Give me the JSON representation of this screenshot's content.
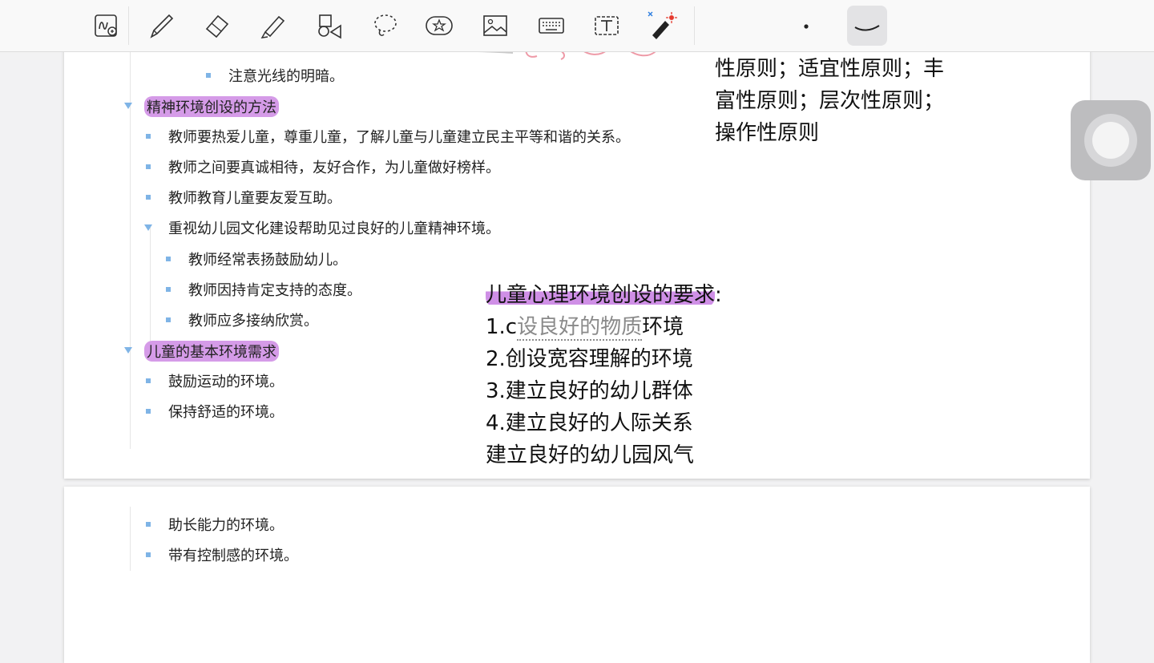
{
  "toolbar": {
    "tools": [
      {
        "name": "handwriting-zoom-icon"
      },
      {
        "name": "pen-icon"
      },
      {
        "name": "eraser-icon"
      },
      {
        "name": "highlighter-icon"
      },
      {
        "name": "shapes-icon"
      },
      {
        "name": "lasso-icon"
      },
      {
        "name": "sticker-icon"
      },
      {
        "name": "image-icon"
      },
      {
        "name": "keyboard-icon"
      },
      {
        "name": "text-box-icon"
      },
      {
        "name": "laser-pointer-icon"
      },
      {
        "name": "stroke-size-dot-icon"
      },
      {
        "name": "stroke-style-icon"
      }
    ],
    "accent": "#7fb4e6"
  },
  "page1": {
    "items": [
      {
        "text": "注意光线的明暗。"
      },
      {
        "text": "精神环境创设的方法"
      },
      {
        "text": "教师要热爱儿童，尊重儿童，了解儿童与儿童建立民主平等和谐的关系。"
      },
      {
        "text": "教师之间要真诚相待，友好合作，为儿童做好榜样。"
      },
      {
        "text": "教师教育儿童要友爱互助。"
      },
      {
        "text": "重视幼儿园文化建设帮助见过良好的儿童精神环境。"
      },
      {
        "text": "教师经常表扬鼓励幼儿。"
      },
      {
        "text": "教师因持肯定支持的态度。"
      },
      {
        "text": " 教师应多接纳欣赏。"
      },
      {
        "text": "儿童的基本环境需求"
      },
      {
        "text": "鼓励运动的环境。"
      },
      {
        "text": "保持舒适的环境。"
      }
    ],
    "handwriting_top": [
      "性原则；适宜性原则；丰",
      "富性原则；层次性原则；",
      "操作性原则"
    ],
    "handwriting_mid": {
      "title": "儿童心理环境创设的要求",
      "title_suffix": ":",
      "line1_prefix": "1.c",
      "line1_struck": "设良好的物质",
      "line1_suffix": "环境",
      "line2": "2.创设宽容理解的环境",
      "line3": "3.建立良好的幼儿群体",
      "line4": "4.建立良好的人际关系",
      "line5": "建立良好的幼儿园风气"
    }
  },
  "page2": {
    "items": [
      {
        "text": "助长能力的环境。"
      },
      {
        "text": "带有控制感的环境。"
      }
    ]
  },
  "colors": {
    "highlight": "#d59be8",
    "bullet": "#7fb4e6",
    "ink_red": "#e8788a"
  }
}
